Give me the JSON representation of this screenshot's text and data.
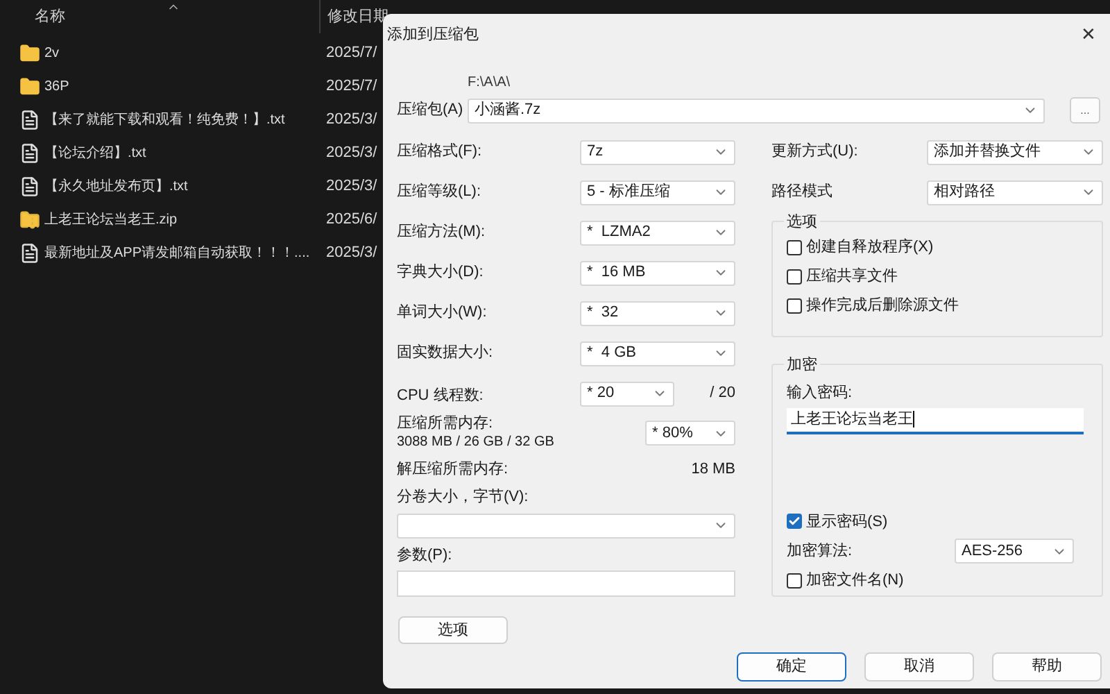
{
  "explorer": {
    "columns": [
      "名称",
      "修改日期"
    ],
    "files": [
      {
        "name": "2v",
        "kind": "folder",
        "modified": "2025/7/"
      },
      {
        "name": "36P",
        "kind": "folder",
        "modified": "2025/7/"
      },
      {
        "name": "【来了就能下载和观看！纯免费！】.txt",
        "kind": "text",
        "modified": "2025/3/"
      },
      {
        "name": "【论坛介绍】.txt",
        "kind": "text",
        "modified": "2025/3/"
      },
      {
        "name": "【永久地址发布页】.txt",
        "kind": "text",
        "modified": "2025/3/"
      },
      {
        "name": "上老王论坛当老王.zip",
        "kind": "zip",
        "modified": "2025/6/"
      },
      {
        "name": "最新地址及APP请发邮箱自动获取！！！....",
        "kind": "text",
        "modified": "2025/3/"
      }
    ]
  },
  "dialog": {
    "title": "添加到压缩包",
    "close": "✕",
    "archive": {
      "label": "压缩包(A)",
      "path": "F:\\A\\A\\",
      "value": "小涵酱.7z",
      "browse": "..."
    },
    "left_fields": [
      {
        "kind": "select",
        "label": "压缩格式(F):",
        "value": "7z"
      },
      {
        "kind": "select",
        "label": "压缩等级(L):",
        "value": "5 - 标准压缩"
      },
      {
        "kind": "select",
        "label": "压缩方法(M):",
        "value": "*  LZMA2"
      },
      {
        "kind": "select",
        "label": "字典大小(D):",
        "value": "*  16 MB"
      },
      {
        "kind": "select",
        "label": "单词大小(W):",
        "value": "*  32"
      },
      {
        "kind": "select",
        "label": "固实数据大小:",
        "value": "*  4 GB"
      },
      {
        "kind": "cpu",
        "label": "CPU 线程数:",
        "value": "* 20",
        "suffix": "/ 20"
      },
      {
        "kind": "memory",
        "label": "压缩所需内存:",
        "detail": "3088 MB / 26 GB / 32 GB",
        "value": "* 80%"
      },
      {
        "kind": "info",
        "label": "解压缩所需内存:",
        "value": "18 MB"
      },
      {
        "kind": "wide_select",
        "label": "分卷大小，字节(V):"
      },
      {
        "kind": "wide_input",
        "label": "参数(P):"
      }
    ],
    "options_button": "选项",
    "right_fields": [
      {
        "label": "更新方式(U):",
        "value": "添加并替换文件"
      },
      {
        "label": "路径模式",
        "value": "相对路径"
      }
    ],
    "options_group": {
      "title": "选项",
      "items": [
        {
          "label": "创建自释放程序(X)",
          "checked": false
        },
        {
          "label": "压缩共享文件",
          "checked": false
        },
        {
          "label": "操作完成后删除源文件",
          "checked": false
        }
      ]
    },
    "encryption": {
      "title": "加密",
      "password_label": "输入密码:",
      "password": "上老王论坛当老王",
      "show_password": {
        "label": "显示密码(S)",
        "checked": true
      },
      "method_label": "加密算法:",
      "method": "AES-256",
      "encrypt_names": {
        "label": "加密文件名(N)",
        "checked": false
      }
    },
    "buttons": [
      {
        "label": "确定",
        "default": true
      },
      {
        "label": "取消",
        "default": false
      },
      {
        "label": "帮助",
        "default": false
      }
    ]
  }
}
